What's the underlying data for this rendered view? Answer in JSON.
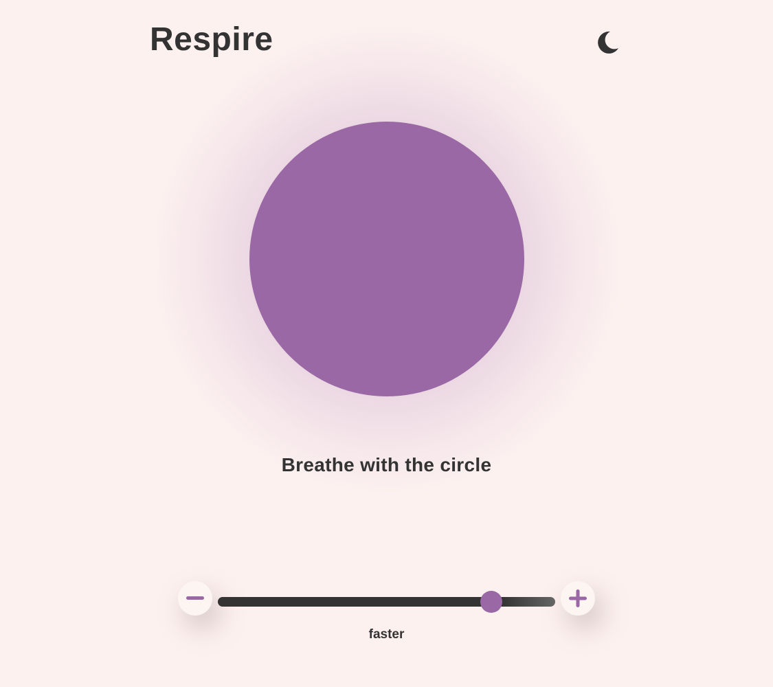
{
  "header": {
    "title": "Respire",
    "theme_toggle_icon": "moon-icon"
  },
  "breath": {
    "instruction": "Breathe with the circle",
    "circle_color": "#9b68a6"
  },
  "speed": {
    "decrease_icon": "minus-icon",
    "increase_icon": "plus-icon",
    "label": "faster",
    "value_fraction": 0.81
  },
  "colors": {
    "background": "#fdf1f0",
    "text": "#333333",
    "accent": "#9b68a6",
    "track": "#333333"
  }
}
